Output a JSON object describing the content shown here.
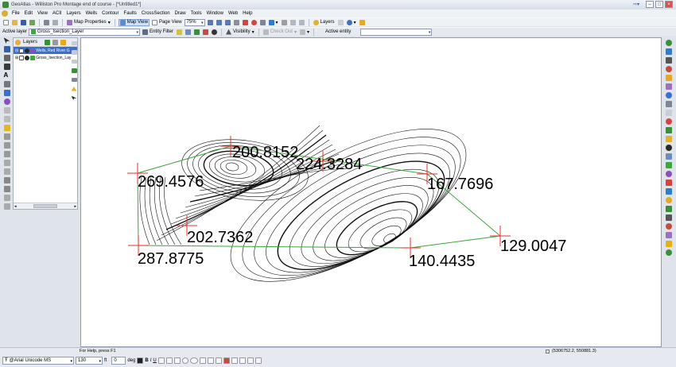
{
  "window": {
    "title": "GeoAtlas - Williston Pro Montage end of course - [*Untitled1*]"
  },
  "menu": [
    "File",
    "Edit",
    "View",
    "ACII",
    "Layers",
    "Wells",
    "Contour",
    "Faults",
    "CrossSection",
    "Draw",
    "Tools",
    "Window",
    "Web",
    "Help"
  ],
  "toolbar1": {
    "map_properties": "Map Properties",
    "map_view": "Map View",
    "page_view": "Page View",
    "zoom": "75%",
    "visibility": "Visibility",
    "layers": "Layers",
    "check_out": "Check Out"
  },
  "toolbar2": {
    "active_layer_label": "Active layer",
    "active_layer_value": "Gross_Isection_Layer",
    "entity_filter": "Entity Filter",
    "active_entity_label": "Active entity",
    "active_entity_value": ""
  },
  "layers_panel": {
    "title": "Layers",
    "items": [
      {
        "label": "Wells, Red River G",
        "selected": true
      },
      {
        "label": "Gross_Isection_Lay",
        "selected": false
      }
    ]
  },
  "map": {
    "wells": [
      {
        "label": "200.8152"
      },
      {
        "label": "224.3284"
      },
      {
        "label": "269.4576"
      },
      {
        "label": "167.7696"
      },
      {
        "label": "202.7362"
      },
      {
        "label": "129.0047"
      },
      {
        "label": "287.8775"
      },
      {
        "label": "140.4435"
      }
    ],
    "marker_color": "#e8302a",
    "boundary_color": "#3aa83a",
    "contour_color": "#111111"
  },
  "status": {
    "help": "For Help, press F1",
    "coords": "(5306752.2, 550881.3)"
  },
  "format_bar": {
    "font": "@Arial Unicode MS",
    "size": "130",
    "unit": "ft",
    "angle": "0",
    "angle_unit": "deg",
    "bold": "B",
    "italic": "I",
    "underline": "U"
  }
}
